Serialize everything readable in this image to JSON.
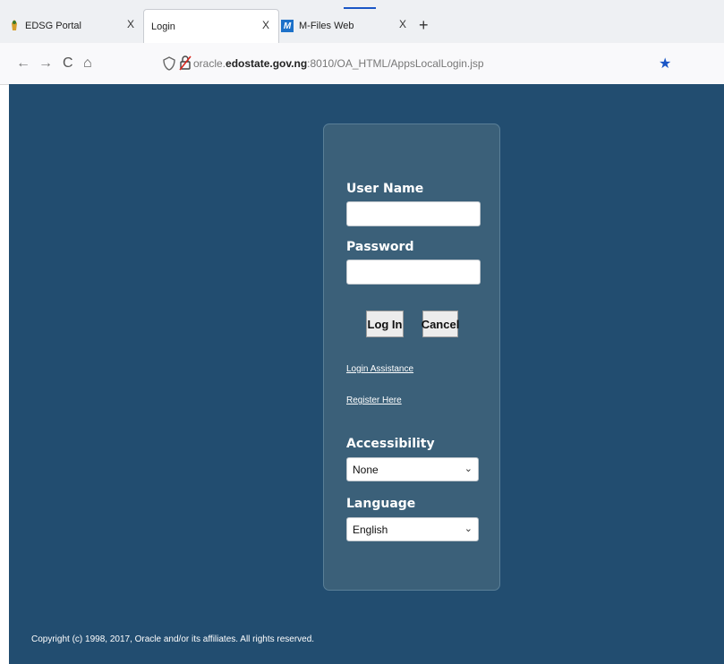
{
  "tabs": [
    {
      "title": "EDSG Portal",
      "close": "X",
      "icon": "edsg-icon"
    },
    {
      "title": "Login",
      "close": "X",
      "icon": null
    },
    {
      "title": "M-Files Web",
      "close": "X",
      "icon": "m-files-icon",
      "icon_letter": "M"
    }
  ],
  "newtab": "+",
  "nav": {
    "back": "←",
    "forward": "→",
    "reload": "C",
    "home": "⌂"
  },
  "url": {
    "prefix": "oracle.",
    "domain": "edostate.gov.ng",
    "suffix": ":8010/OA_HTML/AppsLocalLogin.jsp"
  },
  "login": {
    "username_label": "User Name",
    "password_label": "Password",
    "login_button": "Log In",
    "cancel_button": "Cancel",
    "login_assistance": "Login Assistance",
    "register_here": "Register Here",
    "accessibility_label": "Accessibility",
    "accessibility_value": "None",
    "language_label": "Language",
    "language_value": "English"
  },
  "copyright": "Copyright (c) 1998, 2017, Oracle and/or its affiliates. All rights reserved.",
  "colors": {
    "background": "#224d70",
    "panel": "#3b6079",
    "accent": "#1a56c6"
  }
}
